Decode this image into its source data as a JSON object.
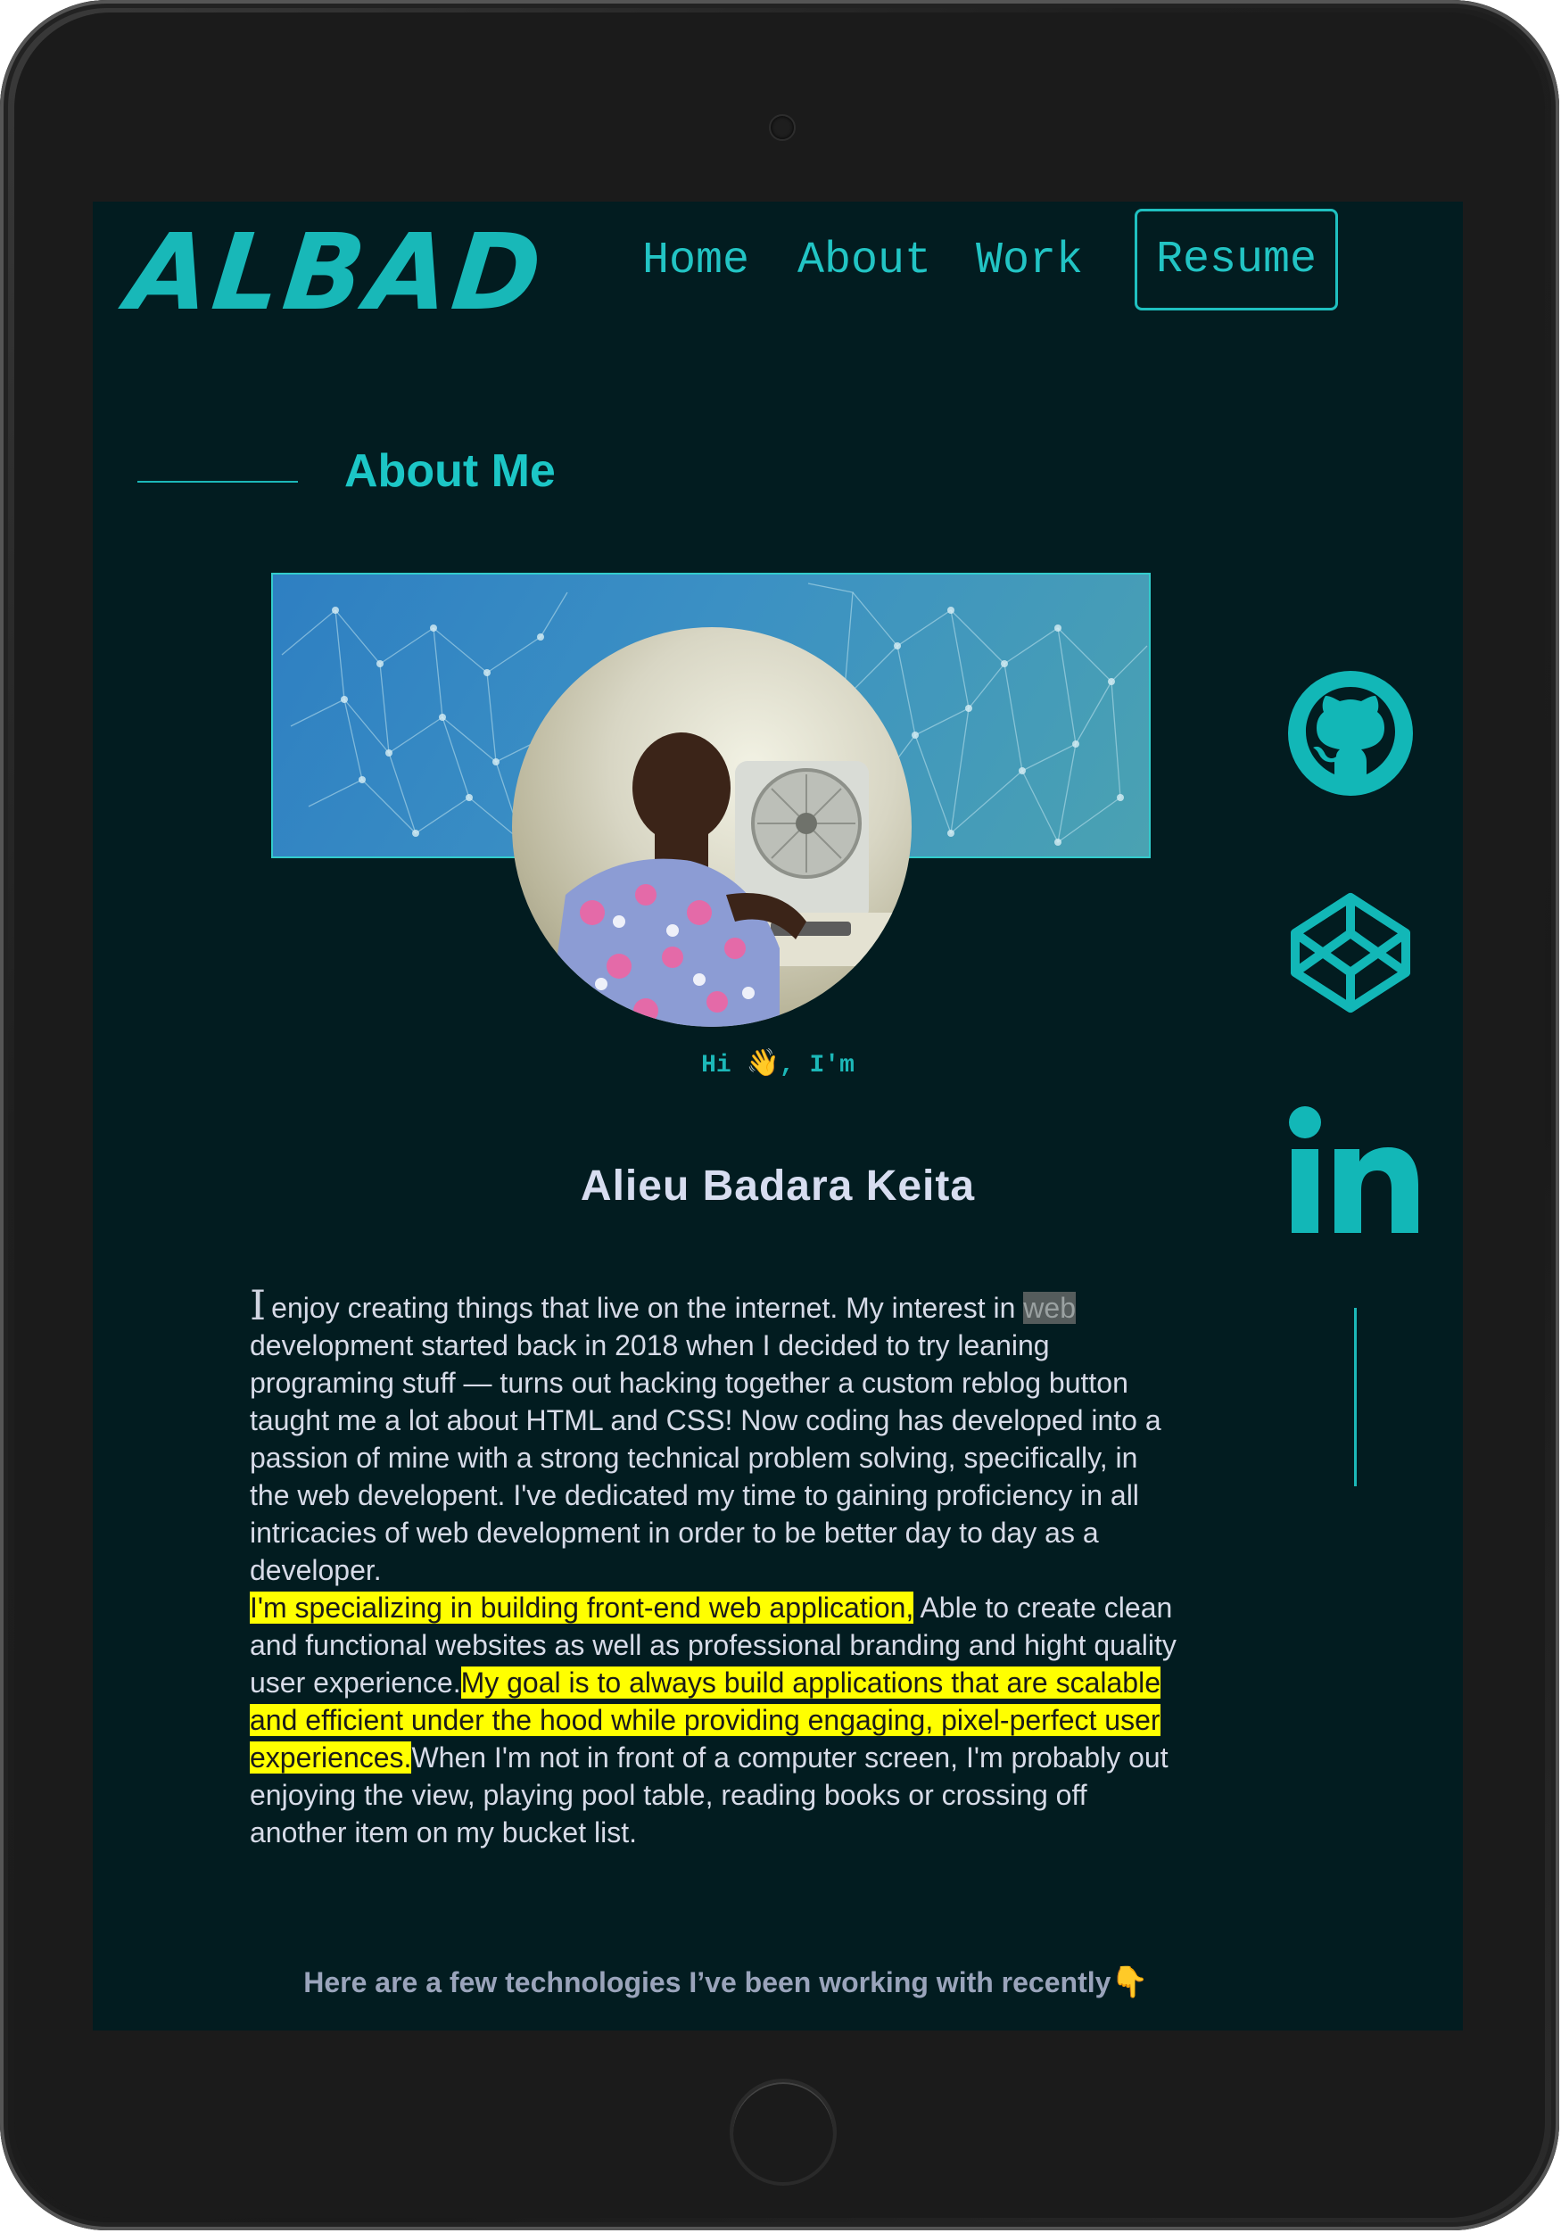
{
  "header": {
    "logo": "ALBAD",
    "nav": [
      {
        "label": "Home"
      },
      {
        "label": "About"
      },
      {
        "label": "Work"
      }
    ],
    "resume_label": "Resume"
  },
  "about": {
    "title": "About Me",
    "greeting_prefix": "Hi ",
    "greeting_emoji": "👋",
    "greeting_suffix": ", I'm",
    "name": "Alieu Badara Keita",
    "bio": {
      "cursor": "I",
      "p1_start": "enjoy creating things that live on the internet. My interest in ",
      "p1_selected": "web",
      "p1_rest": " development started back in 2018 when I decided to try leaning programing stuff — turns out hacking together a custom reblog button taught me a lot about HTML and CSS! Now coding has developed into a passion of mine with a strong technical problem solving, specifically, in the web developent. I've dedicated my time to gaining proficiency in all intricacies of web development in order to be better day to day as a developer.",
      "p2_hl1": "I'm specializing in building front-end web application,",
      "p2_mid": " Able to create clean and functional websites as well as professional branding and hight quality user experience.",
      "p2_hl2": "My goal is to always build applications that are scalable and efficient under the hood while providing engaging, pixel-perfect user experiences.",
      "p2_end": "When I'm not in front of a computer screen, I'm probably out enjoying the view, playing pool table, reading books or crossing off another item on my bucket list."
    },
    "tech_heading": "Here are a few technologies I’ve been working with recently",
    "tech_emoji": "👇"
  },
  "social": [
    {
      "icon": "github-icon"
    },
    {
      "icon": "codepen-icon"
    },
    {
      "icon": "linkedin-icon"
    }
  ],
  "colors": {
    "background": "#021c20",
    "accent": "#1cb8b8",
    "highlight": "#ffff00"
  }
}
